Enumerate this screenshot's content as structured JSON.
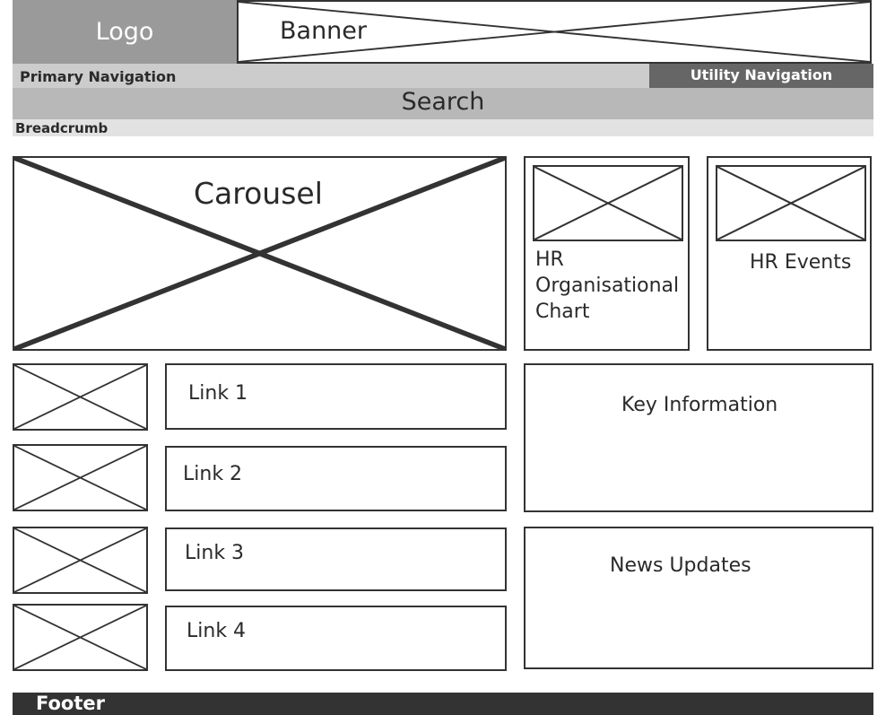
{
  "header": {
    "logo": "Logo",
    "banner": "Banner"
  },
  "nav": {
    "primary": "Primary Navigation",
    "utility": "Utility Navigation",
    "search": "Search",
    "breadcrumb": "Breadcrumb"
  },
  "main": {
    "carousel": "Carousel",
    "hr_org_chart": "HR Organisational Chart",
    "hr_events": "HR Events",
    "links": [
      "Link 1",
      "Link 2",
      "Link 3",
      "Link 4"
    ],
    "key_information": "Key Information",
    "news_updates": "News Updates"
  },
  "footer": {
    "label": "Footer"
  },
  "colors": {
    "logo_bg": "#9a9a9a",
    "primary_nav_bg": "#cccccc",
    "utility_nav_bg": "#666666",
    "search_bg": "#b8b8b8",
    "breadcrumb_bg": "#e2e2e2",
    "footer_bg": "#333333",
    "outline": "#333333"
  }
}
